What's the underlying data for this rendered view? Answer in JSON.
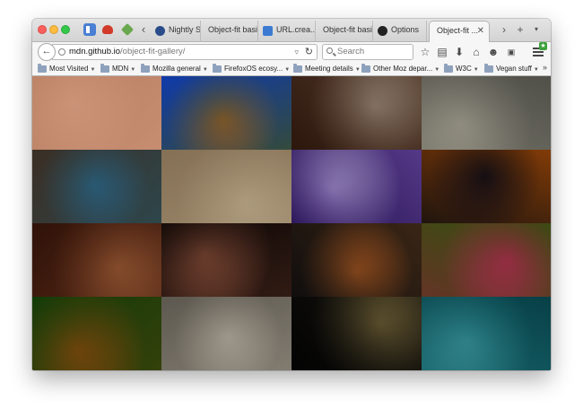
{
  "browser": {
    "tabs": [
      {
        "label": "Nightly St...",
        "active": false
      },
      {
        "label": "Object-fit basi...",
        "active": false
      },
      {
        "label": "URL.crea...",
        "active": false
      },
      {
        "label": "Object-fit basi...",
        "active": false
      },
      {
        "label": "Options",
        "active": false
      },
      {
        "label": "Object-fit ...",
        "active": true
      }
    ],
    "url": {
      "host": "mdn.github.io",
      "path": "/object-fit-gallery/"
    },
    "search_placeholder": "Search",
    "bookmarks": [
      {
        "label": "Most Visited"
      },
      {
        "label": "MDN"
      },
      {
        "label": "Mozilla general"
      },
      {
        "label": "FirefoxOS ecosy..."
      },
      {
        "label": "Meeting details"
      },
      {
        "label": "Other Moz depar..."
      },
      {
        "label": "W3C"
      },
      {
        "label": "Vegan stuff"
      }
    ],
    "icons": {
      "back": "back-arrow-icon",
      "reload": "reload-icon",
      "bookmark_star": "star-icon",
      "reading_list": "reading-list-icon",
      "download": "download-icon",
      "home": "home-icon",
      "hello": "chat-icon",
      "youtube": "youtube-icon",
      "menu": "hamburger-menu-icon"
    }
  },
  "gallery": {
    "tiles": [
      {
        "subject": "eye close-up",
        "colors": [
          "#d9b39e",
          "#e9c9b6"
        ]
      },
      {
        "subject": "fairground ride against blue sky",
        "colors": [
          "#3e7ad0",
          "#d49b4a"
        ]
      },
      {
        "subject": "drum kit",
        "colors": [
          "#6a4c3a",
          "#c8c0b6"
        ]
      },
      {
        "subject": "rocky shoreline",
        "colors": [
          "#8f8f88",
          "#c9c6bd"
        ]
      },
      {
        "subject": "woman sitting on rocks",
        "colors": [
          "#7a6c60",
          "#5fa6c8"
        ]
      },
      {
        "subject": "wave-shaped rock",
        "colors": [
          "#b8a993",
          "#d6cbb7"
        ]
      },
      {
        "subject": "purple flowers",
        "colors": [
          "#5d3f8d",
          "#e8e6f4"
        ]
      },
      {
        "subject": "egyptian wall painting",
        "colors": [
          "#b67b2b",
          "#2c2a52"
        ]
      },
      {
        "subject": "copper sculpture",
        "colors": [
          "#6e4430",
          "#c89a76"
        ]
      },
      {
        "subject": "man with hands raised",
        "colors": [
          "#3a2a24",
          "#d9a58d"
        ]
      },
      {
        "subject": "father and child screaming",
        "colors": [
          "#403b3b",
          "#e8a35d"
        ]
      },
      {
        "subject": "child in pink dress on grass",
        "colors": [
          "#6f8f3b",
          "#e65da0"
        ]
      },
      {
        "subject": "butterfly on leaf",
        "colors": [
          "#3f7a2d",
          "#d0863a"
        ]
      },
      {
        "subject": "metal rods",
        "colors": [
          "#9a968e",
          "#d7d3cb"
        ]
      },
      {
        "subject": "turtle in dark water",
        "colors": [
          "#1c1c1c",
          "#b1a47a"
        ]
      },
      {
        "subject": "manatee in blue water",
        "colors": [
          "#2d7f86",
          "#7cc2c6"
        ]
      }
    ]
  }
}
